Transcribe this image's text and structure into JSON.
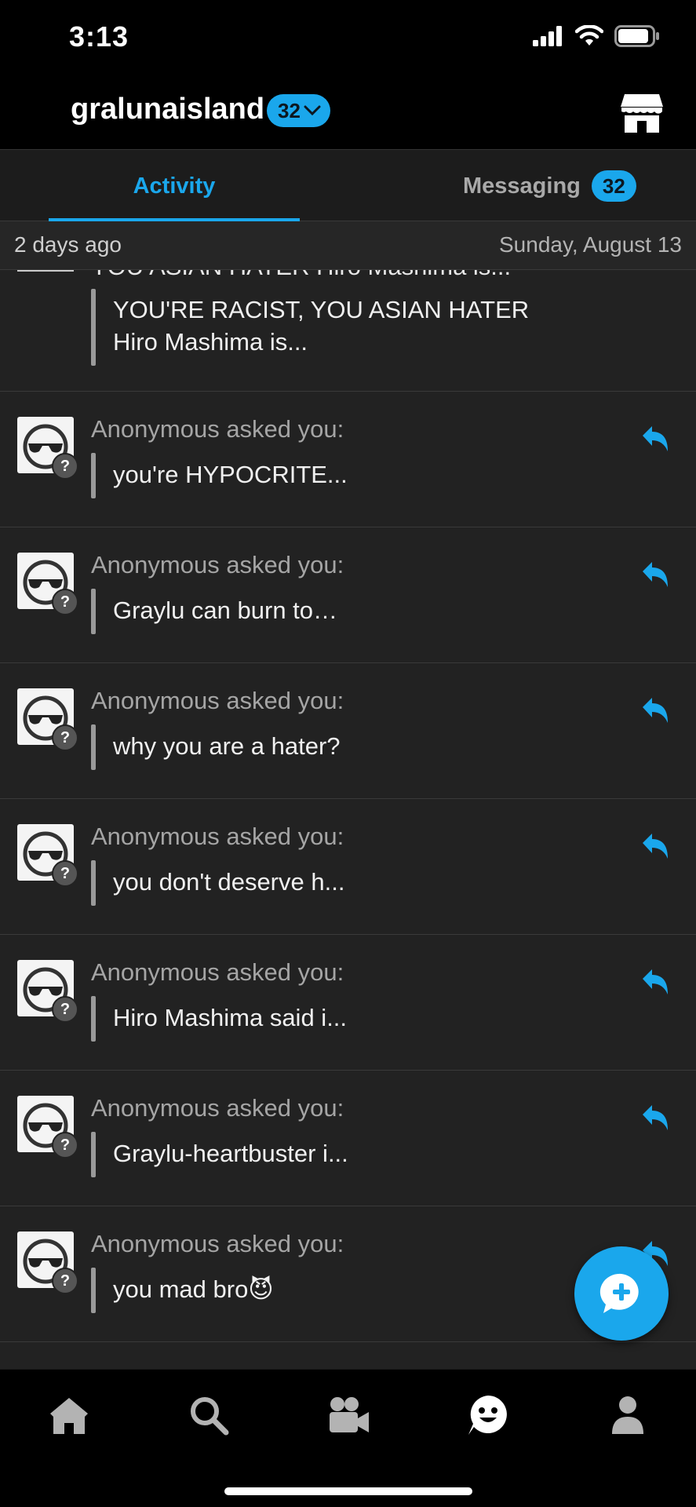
{
  "status_bar": {
    "time": "3:13",
    "signal_icon": "signal-icon",
    "wifi_icon": "wifi-icon",
    "battery_icon": "battery-icon"
  },
  "header": {
    "blog_name": "gralunaisland",
    "badge_count": "32",
    "shop_icon": "shop-icon"
  },
  "tabs": {
    "activity_label": "Activity",
    "messaging_label": "Messaging",
    "messaging_badge": "32"
  },
  "date_row": {
    "relative": "2 days ago",
    "absolute": "Sunday, August 13"
  },
  "first_item": {
    "cut_text": "YOU ASIAN HATER Hiro Mashima is...",
    "lines": [
      "YOU'RE RACIST, YOU ASIAN HATER",
      "Hiro Mashima is..."
    ]
  },
  "asks": [
    {
      "asker": "Anonymous asked you:",
      "question": "you're HYPOCRITE..."
    },
    {
      "asker": "Anonymous asked you:",
      "question": "Graylu can burn to…"
    },
    {
      "asker": "Anonymous asked you:",
      "question": "why you are a hater?"
    },
    {
      "asker": "Anonymous asked you:",
      "question": "you don't deserve h..."
    },
    {
      "asker": "Anonymous asked you:",
      "question": "Hiro Mashima said i..."
    },
    {
      "asker": "Anonymous asked you:",
      "question": "Graylu-heartbuster i..."
    },
    {
      "asker": "Anonymous asked you:",
      "question": "you mad bro😈"
    }
  ],
  "avatar_badge": "?",
  "accent_color": "#1aa7ec",
  "nav": [
    "home-icon",
    "search-icon",
    "video-icon",
    "activity-icon",
    "account-icon"
  ]
}
